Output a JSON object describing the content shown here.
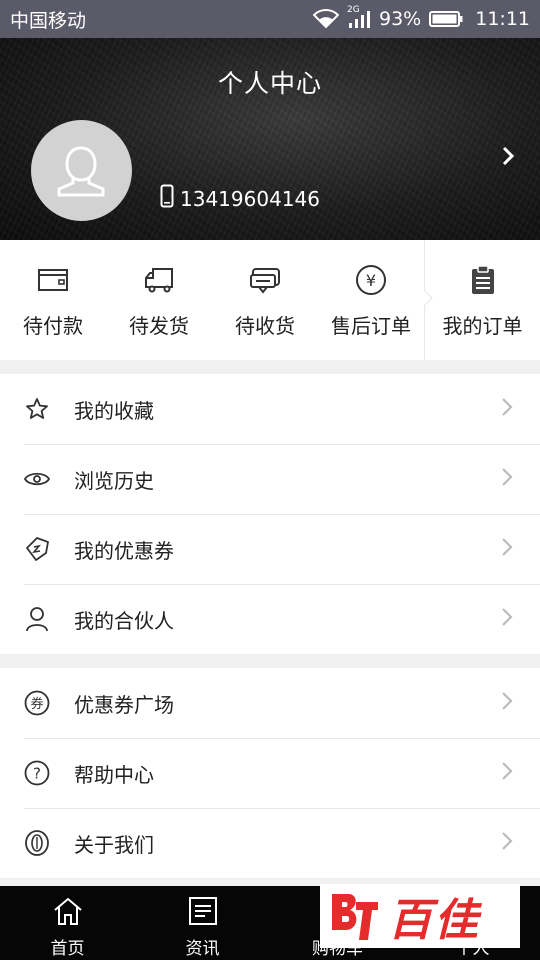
{
  "status_bar": {
    "carrier": "中国移动",
    "network": "2G",
    "battery": "93%",
    "time": "11:11"
  },
  "header": {
    "title": "个人中心",
    "phone": "13419604146"
  },
  "orders": {
    "items": [
      {
        "label": "待付款",
        "icon": "wallet-icon"
      },
      {
        "label": "待发货",
        "icon": "truck-icon"
      },
      {
        "label": "待收货",
        "icon": "receive-icon"
      },
      {
        "label": "售后订单",
        "icon": "yen-icon"
      }
    ],
    "all_label": "我的订单"
  },
  "menu_group_1": [
    {
      "label": "我的收藏",
      "icon": "star-icon"
    },
    {
      "label": "浏览历史",
      "icon": "eye-icon"
    },
    {
      "label": "我的优惠券",
      "icon": "coupon-tag-icon"
    },
    {
      "label": "我的合伙人",
      "icon": "person-icon"
    }
  ],
  "menu_group_2": [
    {
      "label": "优惠券广场",
      "icon": "coupon-circle-icon"
    },
    {
      "label": "帮助中心",
      "icon": "help-icon"
    },
    {
      "label": "关于我们",
      "icon": "about-icon"
    }
  ],
  "tabbar": {
    "items": [
      {
        "label": "首页",
        "icon": "home-icon"
      },
      {
        "label": "资讯",
        "icon": "news-icon"
      },
      {
        "label": "购物车",
        "icon": "cart-icon"
      },
      {
        "label": "个人",
        "icon": "user-icon"
      }
    ]
  },
  "watermark": {
    "text": "百佳"
  },
  "colors": {
    "header_bg": "#1c1c1c",
    "tabbar_bg": "#060606",
    "watermark": "#e52b2b",
    "separator": "#f0f0f0"
  }
}
